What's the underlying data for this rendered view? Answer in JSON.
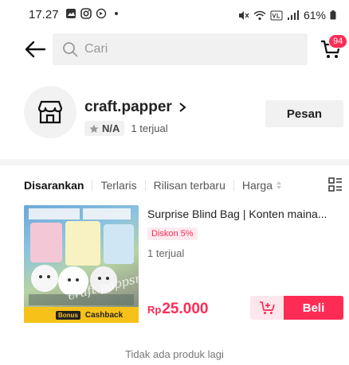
{
  "status_bar": {
    "time": "17.27",
    "left_icons": [
      "gallery-icon",
      "instagram-icon",
      "app-icon",
      "dot-icon"
    ],
    "right_icons": [
      "mute-icon",
      "wifi-icon",
      "volte-icon",
      "signal-icon"
    ],
    "battery": "61%"
  },
  "header": {
    "search_placeholder": "Cari",
    "cart_count": "94"
  },
  "shop": {
    "name": "craft.papper",
    "rating": "N/A",
    "sold": "1 terjual",
    "message_button": "Pesan"
  },
  "tabs": [
    {
      "label": "Disarankan",
      "active": true
    },
    {
      "label": "Terlaris",
      "active": false
    },
    {
      "label": "Rilisan terbaru",
      "active": false
    },
    {
      "label": "Harga",
      "active": false
    }
  ],
  "product": {
    "title": "Surprise Blind Bag | Konten maina...",
    "discount": "Diskon 5%",
    "sold": "1 terjual",
    "price_currency": "Rp",
    "price_value": "25.000",
    "banner_tag": "Bonus",
    "banner_text": "Cashback",
    "watermark": "craft.pappsr",
    "buy_label": "Beli"
  },
  "footer": {
    "text": "Tidak ada produk lagi"
  },
  "colors": {
    "accent": "#fe2c55",
    "accent_light": "#fde6ec",
    "banner": "#f6c21a"
  }
}
